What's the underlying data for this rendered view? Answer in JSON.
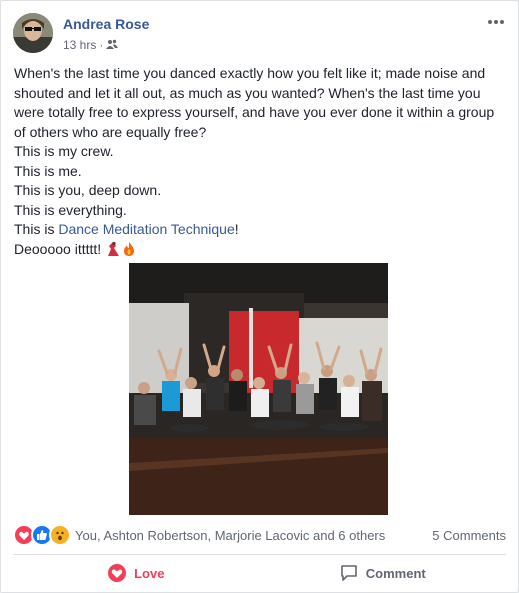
{
  "post": {
    "author": "Andrea Rose",
    "time": "13 hrs",
    "separator": "·",
    "audience_icon": "friends-icon",
    "paragraphs": [
      "When's the last time you danced exactly how you felt like it; made noise and shouted and let it all out, as much as you wanted? When's the last time you were totally free to express yourself, and have you ever done it within a group of others who are equally free?",
      "This is my crew.",
      "This is me.",
      "This is you, deep down.",
      "This is everything."
    ],
    "link_prefix": "This is ",
    "link_text": "Dance Meditation Technique",
    "link_suffix": "!",
    "last_line": "Deooooo ittttt!"
  },
  "reactions": {
    "icons": [
      "love-reaction-icon",
      "like-reaction-icon",
      "wow-reaction-icon"
    ],
    "summary": "You, Ashton Robertson, Marjorie Lacovic and 6 others",
    "comments": "5 Comments"
  },
  "actions": {
    "love_label": "Love",
    "comment_label": "Comment"
  },
  "colors": {
    "link": "#385898",
    "love": "#f33e58",
    "like": "#1877f2",
    "wow": "#f7b125"
  }
}
